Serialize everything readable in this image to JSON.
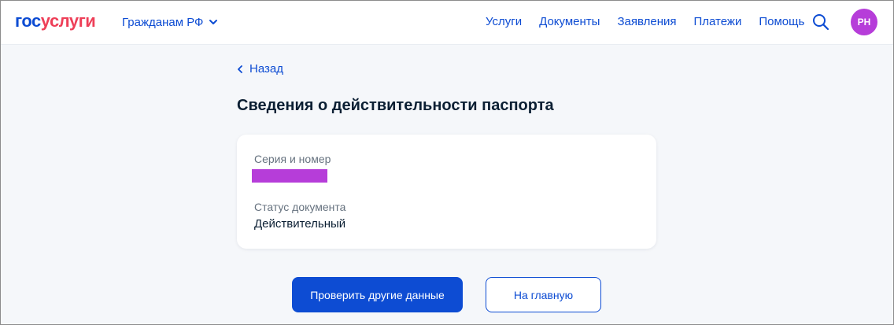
{
  "header": {
    "logo_part1": "гос",
    "logo_part2": "услуги",
    "region_label": "Гражданам РФ",
    "nav": [
      "Услуги",
      "Документы",
      "Заявления",
      "Платежи",
      "Помощь"
    ],
    "avatar_initials": "PH"
  },
  "content": {
    "back_label": "Назад",
    "title": "Сведения о действительности паспорта",
    "card": {
      "series_label": "Серия и номер",
      "status_label": "Статус документа",
      "status_value": "Действительный"
    },
    "primary_button": "Проверить другие данные",
    "secondary_button": "На главную"
  },
  "colors": {
    "brand_blue": "#0d4cd3",
    "brand_red": "#ee3f58",
    "avatar_bg": "#b63dd9",
    "redaction": "#b63dd9"
  },
  "icons": {
    "region_chevron": "chevron-down-icon",
    "search": "search-icon",
    "back": "chevron-left-icon"
  }
}
